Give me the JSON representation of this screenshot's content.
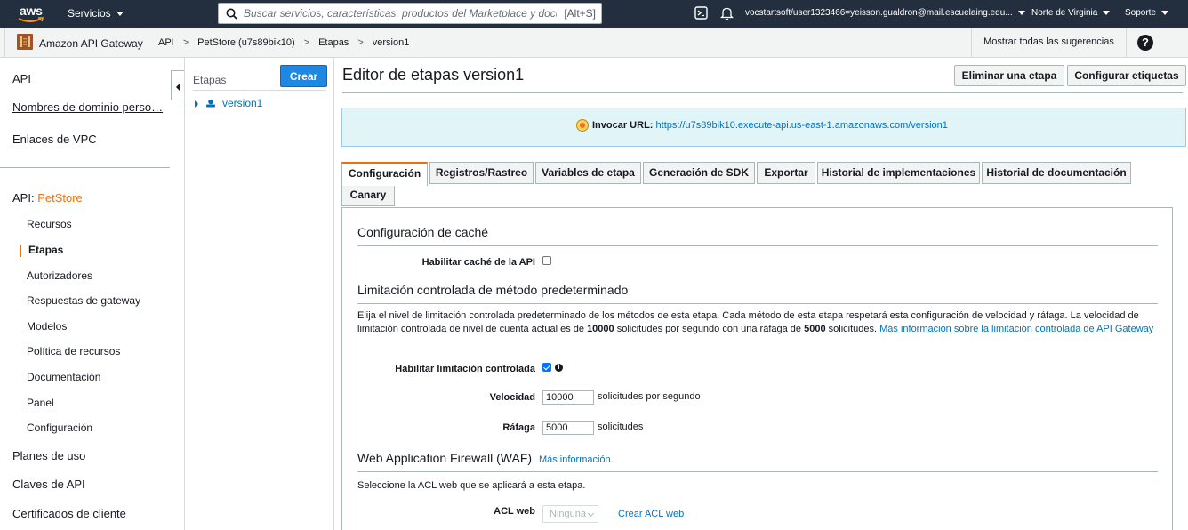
{
  "topnav": {
    "logo_text": "aws",
    "services_label": "Servicios",
    "search_placeholder": "Buscar servicios, características, productos del Marketplace y documentos",
    "search_shortcut": "[Alt+S]",
    "user": "vocstartsoft/user1323466=yeisson.gualdron@mail.escuelaing.edu...",
    "region": "Norte de Virginia",
    "support": "Soporte"
  },
  "breadcrumb": {
    "service_name": "Amazon API Gateway",
    "items": [
      "API",
      "PetStore (u7s89bik10)",
      "Etapas",
      "version1"
    ],
    "suggestions": "Mostrar todas las sugerencias",
    "help": "?"
  },
  "sidebar": {
    "top_items": [
      "API",
      "Nombres de dominio perso…",
      "Enlaces de VPC"
    ],
    "api_prefix": "API:",
    "api_name": "PetStore",
    "sub_items": [
      "Recursos",
      "Etapas",
      "Autorizadores",
      "Respuestas de gateway",
      "Modelos",
      "Política de recursos",
      "Documentación",
      "Panel",
      "Configuración"
    ],
    "active_sub": "Etapas",
    "bottom_items": [
      "Planes de uso",
      "Claves de API",
      "Certificados de cliente"
    ]
  },
  "stages": {
    "label": "Etapas",
    "create_button": "Crear",
    "items": [
      "version1"
    ]
  },
  "main": {
    "title": "Editor de etapas version1",
    "delete_button": "Eliminar una etapa",
    "tags_button": "Configurar etiquetas",
    "invoke_label": "Invocar URL:",
    "invoke_url": "https://u7s89bik10.execute-api.us-east-1.amazonaws.com/version1",
    "tabs": [
      "Configuración",
      "Registros/Rastreo",
      "Variables de etapa",
      "Generación de SDK",
      "Exportar",
      "Historial de implementaciones",
      "Historial de documentación",
      "Canary"
    ],
    "active_tab": "Configuración"
  },
  "settings": {
    "cache_title": "Configuración de caché",
    "cache_label": "Habilitar caché de la API",
    "cache_enabled": false,
    "throttle_title": "Limitación controlada de método predeterminado",
    "throttle_text_1": "Elija el nivel de limitación controlada predeterminado de los métodos de esta etapa. Cada método de esta etapa respetará esta configuración de velocidad y ráfaga. La velocidad de limitación controlada de nivel de cuenta actual es de ",
    "throttle_rate_bold": "10000",
    "throttle_text_2": " solicitudes por segundo con una ráfaga de ",
    "throttle_burst_bold": "5000",
    "throttle_text_3": " solicitudes. ",
    "throttle_link": "Más información sobre la limitación controlada de API Gateway",
    "throttle_enable_label": "Habilitar limitación controlada",
    "throttle_enabled": true,
    "rate_label": "Velocidad",
    "rate_value": "10000",
    "rate_unit": "solicitudes por segundo",
    "burst_label": "Ráfaga",
    "burst_value": "5000",
    "burst_unit": "solicitudes",
    "waf_title": "Web Application Firewall (WAF)",
    "waf_more": "Más información.",
    "waf_text": "Seleccione la ACL web que se aplicará a esta etapa.",
    "acl_label": "ACL web",
    "acl_value": "Ninguna",
    "acl_create": "Crear ACL web"
  },
  "colors": {
    "nav_bg": "#232f3e",
    "accent": "#ec7211",
    "link": "#0073bb",
    "primary_button": "#1e88e5",
    "info_bg": "#e1f4f8"
  }
}
